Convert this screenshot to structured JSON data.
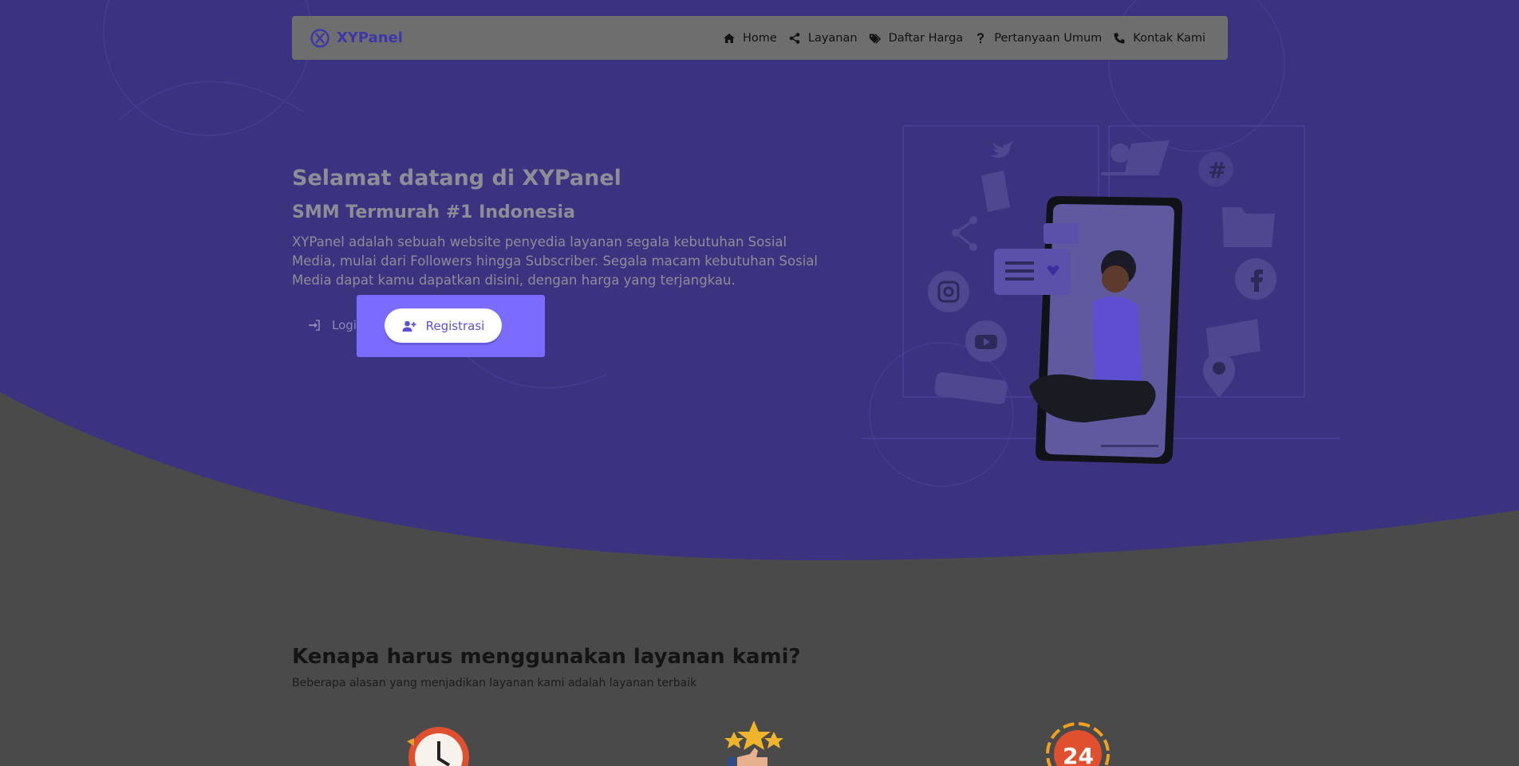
{
  "navbar": {
    "brand": "XYPanel",
    "items": [
      {
        "label": "Home",
        "icon": "home-icon"
      },
      {
        "label": "Layanan",
        "icon": "share-icon"
      },
      {
        "label": "Daftar Harga",
        "icon": "tags-icon"
      },
      {
        "label": "Pertanyaan Umum",
        "icon": "question-icon"
      },
      {
        "label": "Kontak Kami",
        "icon": "phone-icon"
      }
    ]
  },
  "hero": {
    "title": "Selamat datang di XYPanel",
    "subtitle": "SMM Termurah #1 Indonesia",
    "description": "XYPanel adalah sebuah website penyedia layanan segala kebutuhan Sosial Media, mulai dari Followers hingga Subscriber. Segala macam kebutuhan Sosial Media dapat kamu dapatkan disini, dengan harga yang terjangkau.",
    "login_label": "Login",
    "register_label": "Registrasi"
  },
  "why": {
    "title": "Kenapa harus menggunakan layanan kami?",
    "subtitle": "Beberapa alasan yang menjadikan layanan kami adalah layanan terbaik",
    "features": [
      {
        "icon": "clock-icon"
      },
      {
        "icon": "stars-thumbs-up-icon"
      },
      {
        "icon": "24-hours-icon"
      }
    ]
  },
  "colors": {
    "hero_purple": "#3c3380",
    "accent": "#7b6cff",
    "brand": "#3f37a8"
  }
}
